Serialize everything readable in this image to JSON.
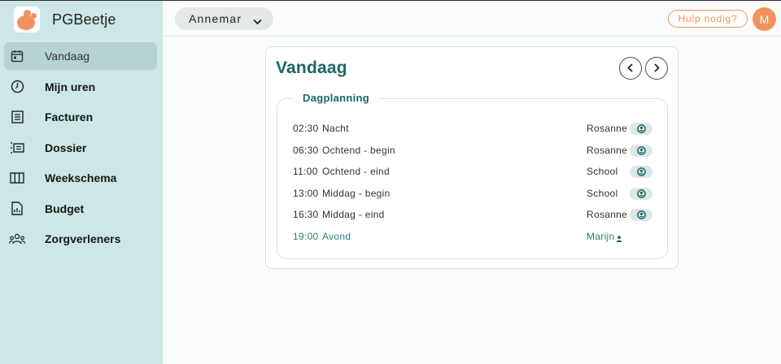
{
  "app": {
    "name": "PGBeetje"
  },
  "colors": {
    "accent": "#1c6666",
    "brand": "#f2915f",
    "sidebar": "#cde6e6"
  },
  "sidebar": {
    "items": [
      {
        "label": "Vandaag",
        "icon": "calendar-icon",
        "active": true
      },
      {
        "label": "Mijn uren",
        "icon": "clock-icon"
      },
      {
        "label": "Facturen",
        "icon": "invoice-icon"
      },
      {
        "label": "Dossier",
        "icon": "list-icon"
      },
      {
        "label": "Weekschema",
        "icon": "columns-icon"
      },
      {
        "label": "Budget",
        "icon": "report-icon"
      },
      {
        "label": "Zorgverleners",
        "icon": "people-icon"
      }
    ]
  },
  "header": {
    "selected_user": "Annemar",
    "help_label": "Hulp nodig?",
    "avatar_initial": "M"
  },
  "main": {
    "title": "Vandaag",
    "section_title": "Dagplanning",
    "schedule": [
      {
        "time": "02:30",
        "slot": "Nacht",
        "person": "Rosanne",
        "icon": "person-badge-icon"
      },
      {
        "time": "06:30",
        "slot": "Ochtend - begin",
        "person": "Rosanne",
        "icon": "person-badge-icon"
      },
      {
        "time": "11:00",
        "slot": "Ochtend - eind",
        "person": "School",
        "icon": "person-badge-icon"
      },
      {
        "time": "13:00",
        "slot": "Middag - begin",
        "person": "School",
        "icon": "person-badge-icon"
      },
      {
        "time": "16:30",
        "slot": "Middag - eind",
        "person": "Rosanne",
        "icon": "person-badge-icon"
      },
      {
        "time": "19:00",
        "slot": "Avond",
        "person": "Marijn",
        "icon": "person-icon",
        "highlight": true
      }
    ]
  }
}
